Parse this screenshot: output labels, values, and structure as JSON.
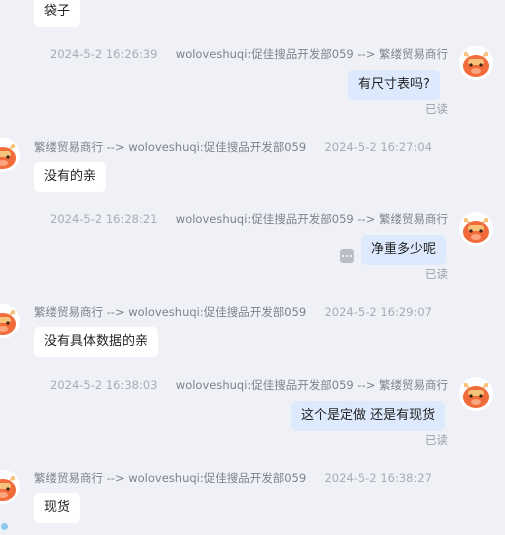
{
  "messages": [
    {
      "dir": "in",
      "text": "袋子"
    },
    {
      "dir": "out",
      "time": "2024-5-2 16:26:39",
      "route": "woloveshuqi:促佳搜品开发部059 --> 繁缕贸易商行",
      "text": "有尺寸表吗?",
      "read": "已读"
    },
    {
      "dir": "in",
      "route": "繁缕贸易商行 --> woloveshuqi:促佳搜品开发部059",
      "time": "2024-5-2 16:27:04",
      "text": "没有的亲"
    },
    {
      "dir": "out",
      "time": "2024-5-2 16:28:21",
      "route": "woloveshuqi:促佳搜品开发部059 --> 繁缕贸易商行",
      "text": "净重多少呢",
      "read": "已读"
    },
    {
      "dir": "in",
      "route": "繁缕贸易商行 --> woloveshuqi:促佳搜品开发部059",
      "time": "2024-5-2 16:29:07",
      "text": "没有具体数据的亲"
    },
    {
      "dir": "out",
      "time": "2024-5-2 16:38:03",
      "route": "woloveshuqi:促佳搜品开发部059 --> 繁缕贸易商行",
      "text": "这个是定做 还是有现货",
      "read": "已读"
    },
    {
      "dir": "in",
      "route": "繁缕贸易商行 --> woloveshuqi:促佳搜品开发部059",
      "time": "2024-5-2 16:38:27",
      "text": "现货"
    }
  ],
  "colors": {
    "avatar": "#f26b3a",
    "avatar_horn": "#f5c37a",
    "bubble_out": "#dde9fd",
    "background": "#eff1f6"
  }
}
